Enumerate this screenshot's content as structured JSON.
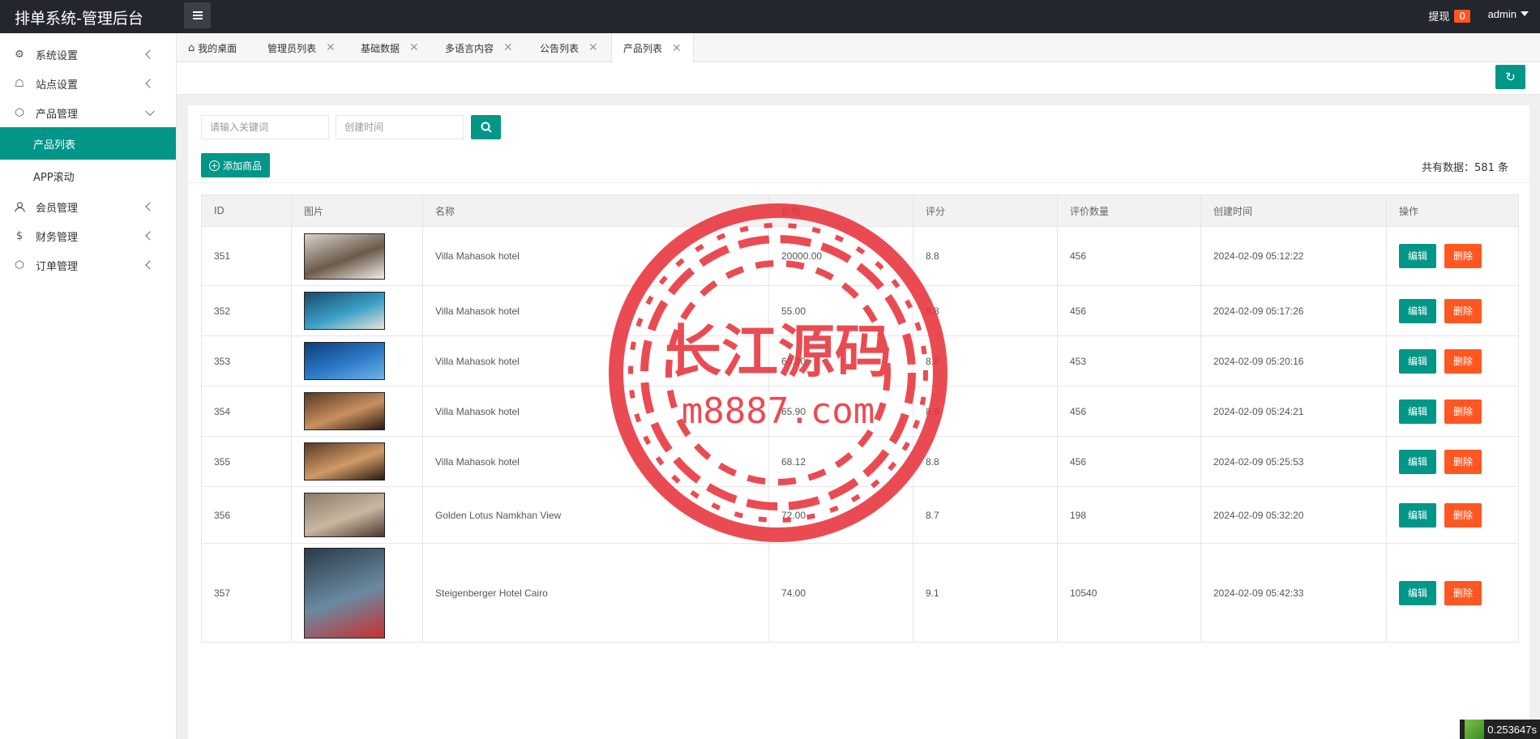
{
  "app": {
    "title": "排单系统-管理后台"
  },
  "topbar": {
    "withdraw_label": "提现",
    "withdraw_count": "0",
    "user": "admin"
  },
  "sidebar": {
    "items": [
      {
        "label": "系统设置",
        "icon": "gear-icon"
      },
      {
        "label": "站点设置",
        "icon": "site-icon"
      },
      {
        "label": "产品管理",
        "icon": "cube-icon"
      },
      {
        "label": "会员管理",
        "icon": "user-icon"
      },
      {
        "label": "财务管理",
        "icon": "dollar-icon"
      },
      {
        "label": "订单管理",
        "icon": "cube-icon"
      }
    ],
    "sub_items": [
      {
        "label": "产品列表",
        "active": true
      },
      {
        "label": "APP滚动",
        "active": false
      }
    ]
  },
  "tabs": [
    {
      "label": "我的桌面"
    },
    {
      "label": "管理员列表"
    },
    {
      "label": "基础数据"
    },
    {
      "label": "多语言内容"
    },
    {
      "label": "公告列表"
    },
    {
      "label": "产品列表"
    }
  ],
  "search": {
    "keyword_placeholder": "请输入关键词",
    "date_placeholder": "创建时间"
  },
  "toolbar": {
    "add_label": "添加商品",
    "total_label": "共有数据：581 条"
  },
  "table": {
    "headers": [
      "ID",
      "图片",
      "名称",
      "价格",
      "评分",
      "评价数量",
      "创建时间",
      "操作"
    ],
    "edit_label": "编辑",
    "delete_label": "删除",
    "rows": [
      {
        "id": "351",
        "name": "Villa Mahasok hotel",
        "price": "20000.00",
        "rating": "8.8",
        "reviews": "456",
        "created": "2024-02-09 05:12:22"
      },
      {
        "id": "352",
        "name": "Villa Mahasok hotel",
        "price": "55.00",
        "rating": "8.8",
        "reviews": "456",
        "created": "2024-02-09 05:17:26"
      },
      {
        "id": "353",
        "name": "Villa Mahasok hotel",
        "price": "60.30",
        "rating": "8.8",
        "reviews": "453",
        "created": "2024-02-09 05:20:16"
      },
      {
        "id": "354",
        "name": "Villa Mahasok hotel",
        "price": "65.90",
        "rating": "8.9",
        "reviews": "456",
        "created": "2024-02-09 05:24:21"
      },
      {
        "id": "355",
        "name": "Villa Mahasok hotel",
        "price": "68.12",
        "rating": "8.8",
        "reviews": "456",
        "created": "2024-02-09 05:25:53"
      },
      {
        "id": "356",
        "name": "Golden Lotus Namkhan View",
        "price": "72.00",
        "rating": "8.7",
        "reviews": "198",
        "created": "2024-02-09 05:32:20"
      },
      {
        "id": "357",
        "name": "Steigenberger Hotel Cairo",
        "price": "74.00",
        "rating": "9.1",
        "reviews": "10540",
        "created": "2024-02-09 05:42:33"
      }
    ]
  },
  "watermark": {
    "line1": "长江源码",
    "line2": "m8887.com"
  },
  "timer": {
    "value": "0.253647s"
  },
  "colors": {
    "primary": "#009688",
    "danger": "#ff5722",
    "topbar": "#23262e",
    "watermark": "#e8333b"
  }
}
